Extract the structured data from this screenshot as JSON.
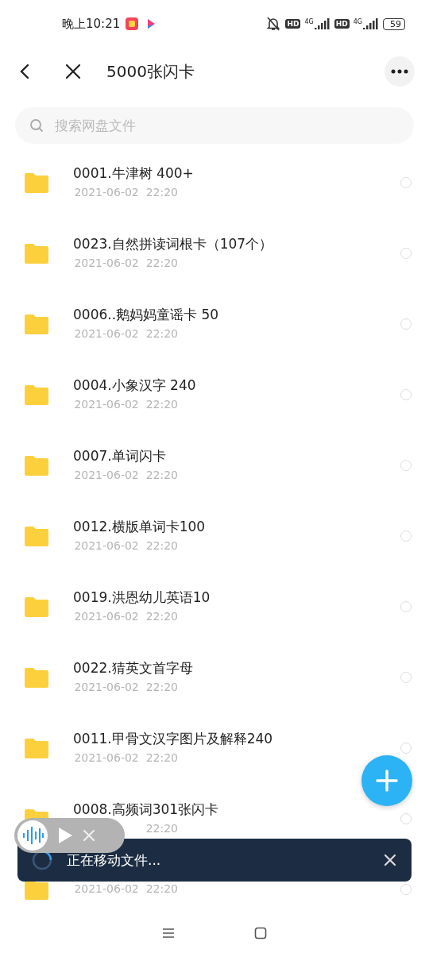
{
  "status_bar": {
    "time": "晚上10:21",
    "sims": [
      {
        "hd": "HD",
        "network": "4G"
      },
      {
        "hd": "HD",
        "network": "4G"
      }
    ],
    "battery": "59"
  },
  "header": {
    "title": "5000张闪卡"
  },
  "search": {
    "placeholder": "搜索网盘文件"
  },
  "files": [
    {
      "name": "0001.牛津树 400+",
      "date": "2021-06-02  22:20",
      "selected": false
    },
    {
      "name": "0023.自然拼读词根卡（107个）",
      "date": "2021-06-02  22:20",
      "selected": false
    },
    {
      "name": "0006..鹅妈妈童谣卡 50",
      "date": "2021-06-02  22:20",
      "selected": false
    },
    {
      "name": "0004.小象汉字 240",
      "date": "2021-06-02  22:20",
      "selected": false
    },
    {
      "name": "0007.单词闪卡",
      "date": "2021-06-02  22:20",
      "selected": false
    },
    {
      "name": "0012.横版单词卡100",
      "date": "2021-06-02  22:20",
      "selected": false
    },
    {
      "name": "0019.洪恩幼儿英语10",
      "date": "2021-06-02  22:20",
      "selected": false
    },
    {
      "name": "0022.猜英文首字母",
      "date": "2021-06-02  22:20",
      "selected": false
    },
    {
      "name": "0011.甲骨文汉字图片及解释240",
      "date": "2021-06-02  22:20",
      "selected": false
    },
    {
      "name": "0008.高频词301张闪卡",
      "date": "22:20",
      "selected": false
    },
    {
      "date": "2021-06-02  22:20",
      "selected": false
    }
  ],
  "toast": {
    "message": "正在移动文件..."
  }
}
